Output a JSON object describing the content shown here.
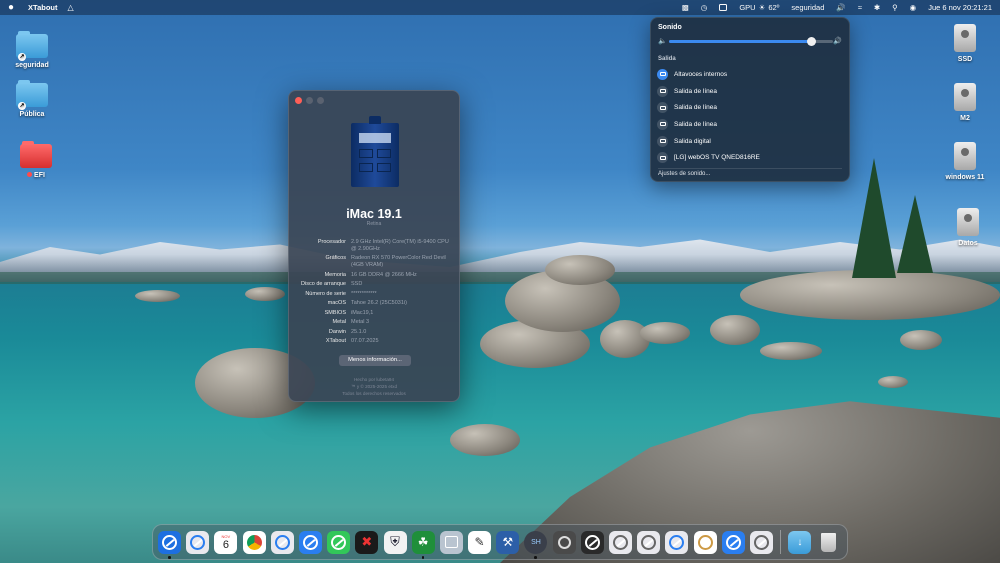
{
  "menubar": {
    "apple": "",
    "app_name": "XTabout",
    "gpu": "GPU",
    "temp": "62º",
    "network": "seguridad",
    "datetime": "Jue 6 nov 20:21:21"
  },
  "desktop": {
    "left_icons": [
      {
        "label": "seguridad"
      },
      {
        "label": "Pública"
      },
      {
        "label": "EFI"
      }
    ],
    "right_icons": [
      {
        "label": "SSD"
      },
      {
        "label": "M2"
      },
      {
        "label": "windows 11"
      },
      {
        "label": "Datos"
      }
    ]
  },
  "about": {
    "title": "iMac 19.1",
    "subtitle": "Retina",
    "specs": [
      {
        "key": "Procesador",
        "value": "2.9 GHz Intel(R) Core(TM) i5-9400 CPU @ 2.90GHz"
      },
      {
        "key": "Gráficos",
        "value": "Radeon RX 570 PowerColor Red Devil (4GB VRAM)"
      },
      {
        "key": "Memoria",
        "value": "16 GB DDR4 @ 2666 MHz"
      },
      {
        "key": "Disco de arranque",
        "value": "SSD"
      },
      {
        "key": "Número de serie",
        "value": "************"
      },
      {
        "key": "macOS",
        "value": "Tahoe 26.2 (25C5031i)"
      },
      {
        "key": "SMBIOS",
        "value": "iMac19,1"
      },
      {
        "key": "Metal",
        "value": "Metal 3"
      },
      {
        "key": "Darwin",
        "value": "25.1.0"
      },
      {
        "key": "XTabout",
        "value": "07.07.2025"
      }
    ],
    "more_button": "Menos información...",
    "footer": [
      "Hecho por lubeta94",
      "™ y © 2025-2025 etxd",
      "Todos los derechos reservados"
    ]
  },
  "sound": {
    "header": "Sonido",
    "volume_fraction": 0.87,
    "output_label": "Salida",
    "devices": [
      {
        "name": "Altavoces internos",
        "active": true
      },
      {
        "name": "Salida de línea",
        "active": false
      },
      {
        "name": "Salida de línea",
        "active": false
      },
      {
        "name": "Salida de línea",
        "active": false
      },
      {
        "name": "Salida digital",
        "active": false
      },
      {
        "name": "[LG] webOS TV QNED816RE",
        "active": false
      }
    ],
    "settings_link": "Ajustes de sonido..."
  },
  "dock": {
    "calendar_month": "NOV",
    "calendar_day": "6",
    "apps": [
      "finder-icon",
      "safari-icon",
      "calendar-icon",
      "chrome-icon",
      "safari-icon",
      "safari-icon",
      "messages-icon",
      "app-icon",
      "app-icon",
      "app-icon",
      "app-icon",
      "app-icon",
      "app-icon",
      "terminal-icon",
      "app-icon",
      "app-icon",
      "app-icon",
      "app-icon",
      "app-icon",
      "app-icon",
      "app-icon"
    ]
  }
}
